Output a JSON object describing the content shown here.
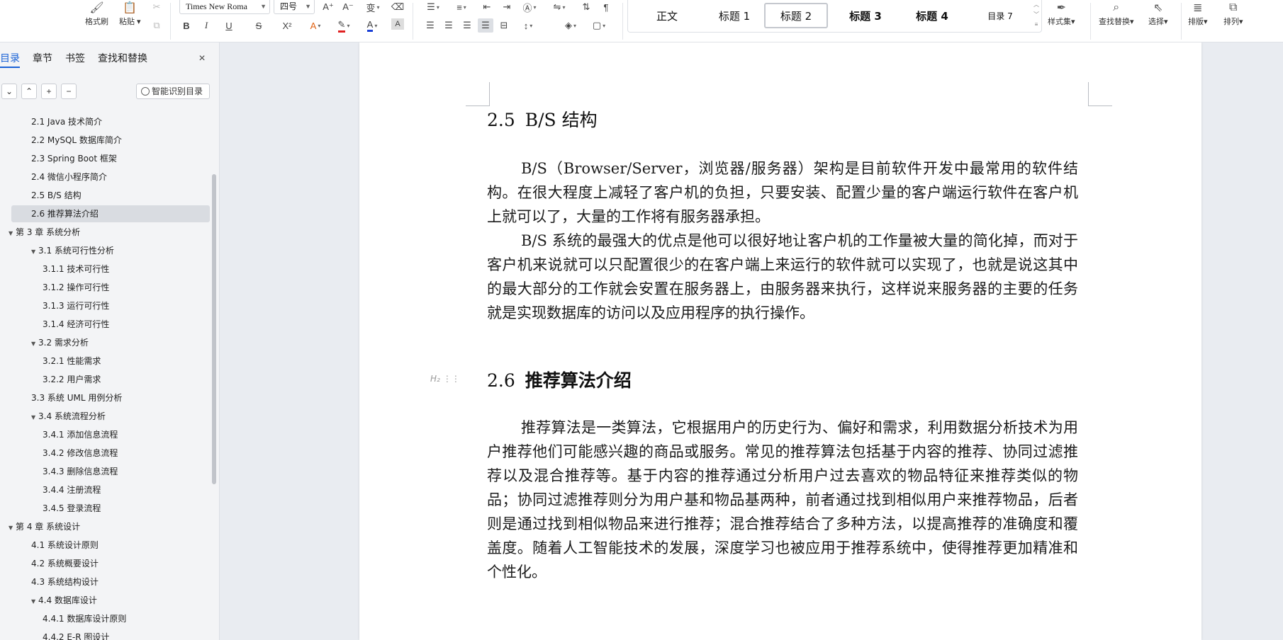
{
  "ribbon": {
    "format_painter": "格式刷",
    "paste": "粘贴",
    "font_name": "Times New Roma",
    "font_size": "四号",
    "styles": [
      {
        "label": "正文",
        "bold": false
      },
      {
        "label": "标题 1",
        "bold": false
      },
      {
        "label": "标题 2",
        "bold": false
      },
      {
        "label": "标题 3",
        "bold": true
      },
      {
        "label": "标题 4",
        "bold": true
      },
      {
        "label": "目录 7",
        "bold": false
      }
    ],
    "style_set": "样式集",
    "find_replace": "查找替换",
    "select": "选择",
    "layout": "排版",
    "arrange": "排列",
    "icons": {
      "bold": "B",
      "italic": "I",
      "underline": "U",
      "strike": "S",
      "superscript": "X²",
      "font_grow": "A⁺",
      "font_shrink": "A⁻"
    }
  },
  "nav": {
    "tabs": [
      "目录",
      "章节",
      "书签",
      "查找和替换"
    ],
    "close": "×",
    "smart_toc": "智能识别目录",
    "tools": {
      "down": "⌄",
      "up": "⌃",
      "add": "+",
      "remove": "−"
    },
    "toc": [
      {
        "text": "2.1  Java 技术简介",
        "level": 2,
        "toggle": ""
      },
      {
        "text": "2.2  MySQL 数据库简介",
        "level": 2,
        "toggle": ""
      },
      {
        "text": "2.3  Spring Boot 框架",
        "level": 2,
        "toggle": ""
      },
      {
        "text": "2.4  微信小程序简介",
        "level": 2,
        "toggle": ""
      },
      {
        "text": "2.5  B/S 结构",
        "level": 2,
        "toggle": ""
      },
      {
        "text": "2.6  推荐算法介绍",
        "level": 2,
        "toggle": "",
        "selected": true
      },
      {
        "text": "第 3 章  系统分析",
        "level": 1,
        "toggle": "▼"
      },
      {
        "text": "3.1  系统可行性分析",
        "level": 2,
        "toggle": "▼"
      },
      {
        "text": "3.1.1  技术可行性",
        "level": 3,
        "toggle": ""
      },
      {
        "text": "3.1.2  操作可行性",
        "level": 3,
        "toggle": ""
      },
      {
        "text": "3.1.3  运行可行性",
        "level": 3,
        "toggle": ""
      },
      {
        "text": "3.1.4  经济可行性",
        "level": 3,
        "toggle": ""
      },
      {
        "text": "3.2  需求分析",
        "level": 2,
        "toggle": "▼"
      },
      {
        "text": "3.2.1  性能需求",
        "level": 3,
        "toggle": ""
      },
      {
        "text": "3.2.2  用户需求",
        "level": 3,
        "toggle": ""
      },
      {
        "text": "3.3  系统 UML 用例分析",
        "level": 2,
        "toggle": ""
      },
      {
        "text": "3.4  系统流程分析",
        "level": 2,
        "toggle": "▼"
      },
      {
        "text": "3.4.1  添加信息流程",
        "level": 3,
        "toggle": ""
      },
      {
        "text": "3.4.2  修改信息流程",
        "level": 3,
        "toggle": ""
      },
      {
        "text": "3.4.3  删除信息流程",
        "level": 3,
        "toggle": ""
      },
      {
        "text": "3.4.4  注册流程",
        "level": 3,
        "toggle": ""
      },
      {
        "text": "3.4.5  登录流程",
        "level": 3,
        "toggle": ""
      },
      {
        "text": "第 4 章  系统设计",
        "level": 1,
        "toggle": "▼"
      },
      {
        "text": "4.1  系统设计原则",
        "level": 2,
        "toggle": ""
      },
      {
        "text": "4.2  系统概要设计",
        "level": 2,
        "toggle": ""
      },
      {
        "text": "4.3  系统结构设计",
        "level": 2,
        "toggle": ""
      },
      {
        "text": "4.4  数据库设计",
        "level": 2,
        "toggle": "▼"
      },
      {
        "text": "4.4.1  数据库设计原则",
        "level": 3,
        "toggle": ""
      },
      {
        "text": "4.4.2  E-R 图设计",
        "level": 3,
        "toggle": ""
      }
    ]
  },
  "document": {
    "h25": {
      "num": "2.5",
      "title": "B/S 结构"
    },
    "p1": "B/S（Browser/Server，浏览器/服务器）架构是目前软件开发中最常用的软件结构。在很大程度上减轻了客户机的负担，只要安装、配置少量的客户端运行软件在客户机上就可以了，大量的工作将有服务器承担。",
    "p2": "B/S 系统的最强大的优点是他可以很好地让客户机的工作量被大量的简化掉，而对于客户机来说就可以只配置很少的在客户端上来运行的软件就可以实现了，也就是说这其中的最大部分的工作就会安置在服务器上，由服务器来执行，这样说来服务器的主要的任务就是实现数据库的访问以及应用程序的执行操作。",
    "h26": {
      "num": "2.6",
      "title": "推荐算法介绍"
    },
    "heading_marker": "H₂",
    "p3": "推荐算法是一类算法，它根据用户的历史行为、偏好和需求，利用数据分析技术为用户推荐他们可能感兴趣的商品或服务。常见的推荐算法包括基于内容的推荐、协同过滤推荐以及混合推荐等。基于内容的推荐通过分析用户过去喜欢的物品特征来推荐类似的物品；协同过滤推荐则分为用户基和物品基两种，前者通过找到相似用户来推荐物品，后者则是通过找到相似物品来进行推荐；混合推荐结合了多种方法，以提高推荐的准确度和覆盖度。随着人工智能技术的发展，深度学习也被应用于推荐系统中，使得推荐更加精准和个性化。"
  }
}
